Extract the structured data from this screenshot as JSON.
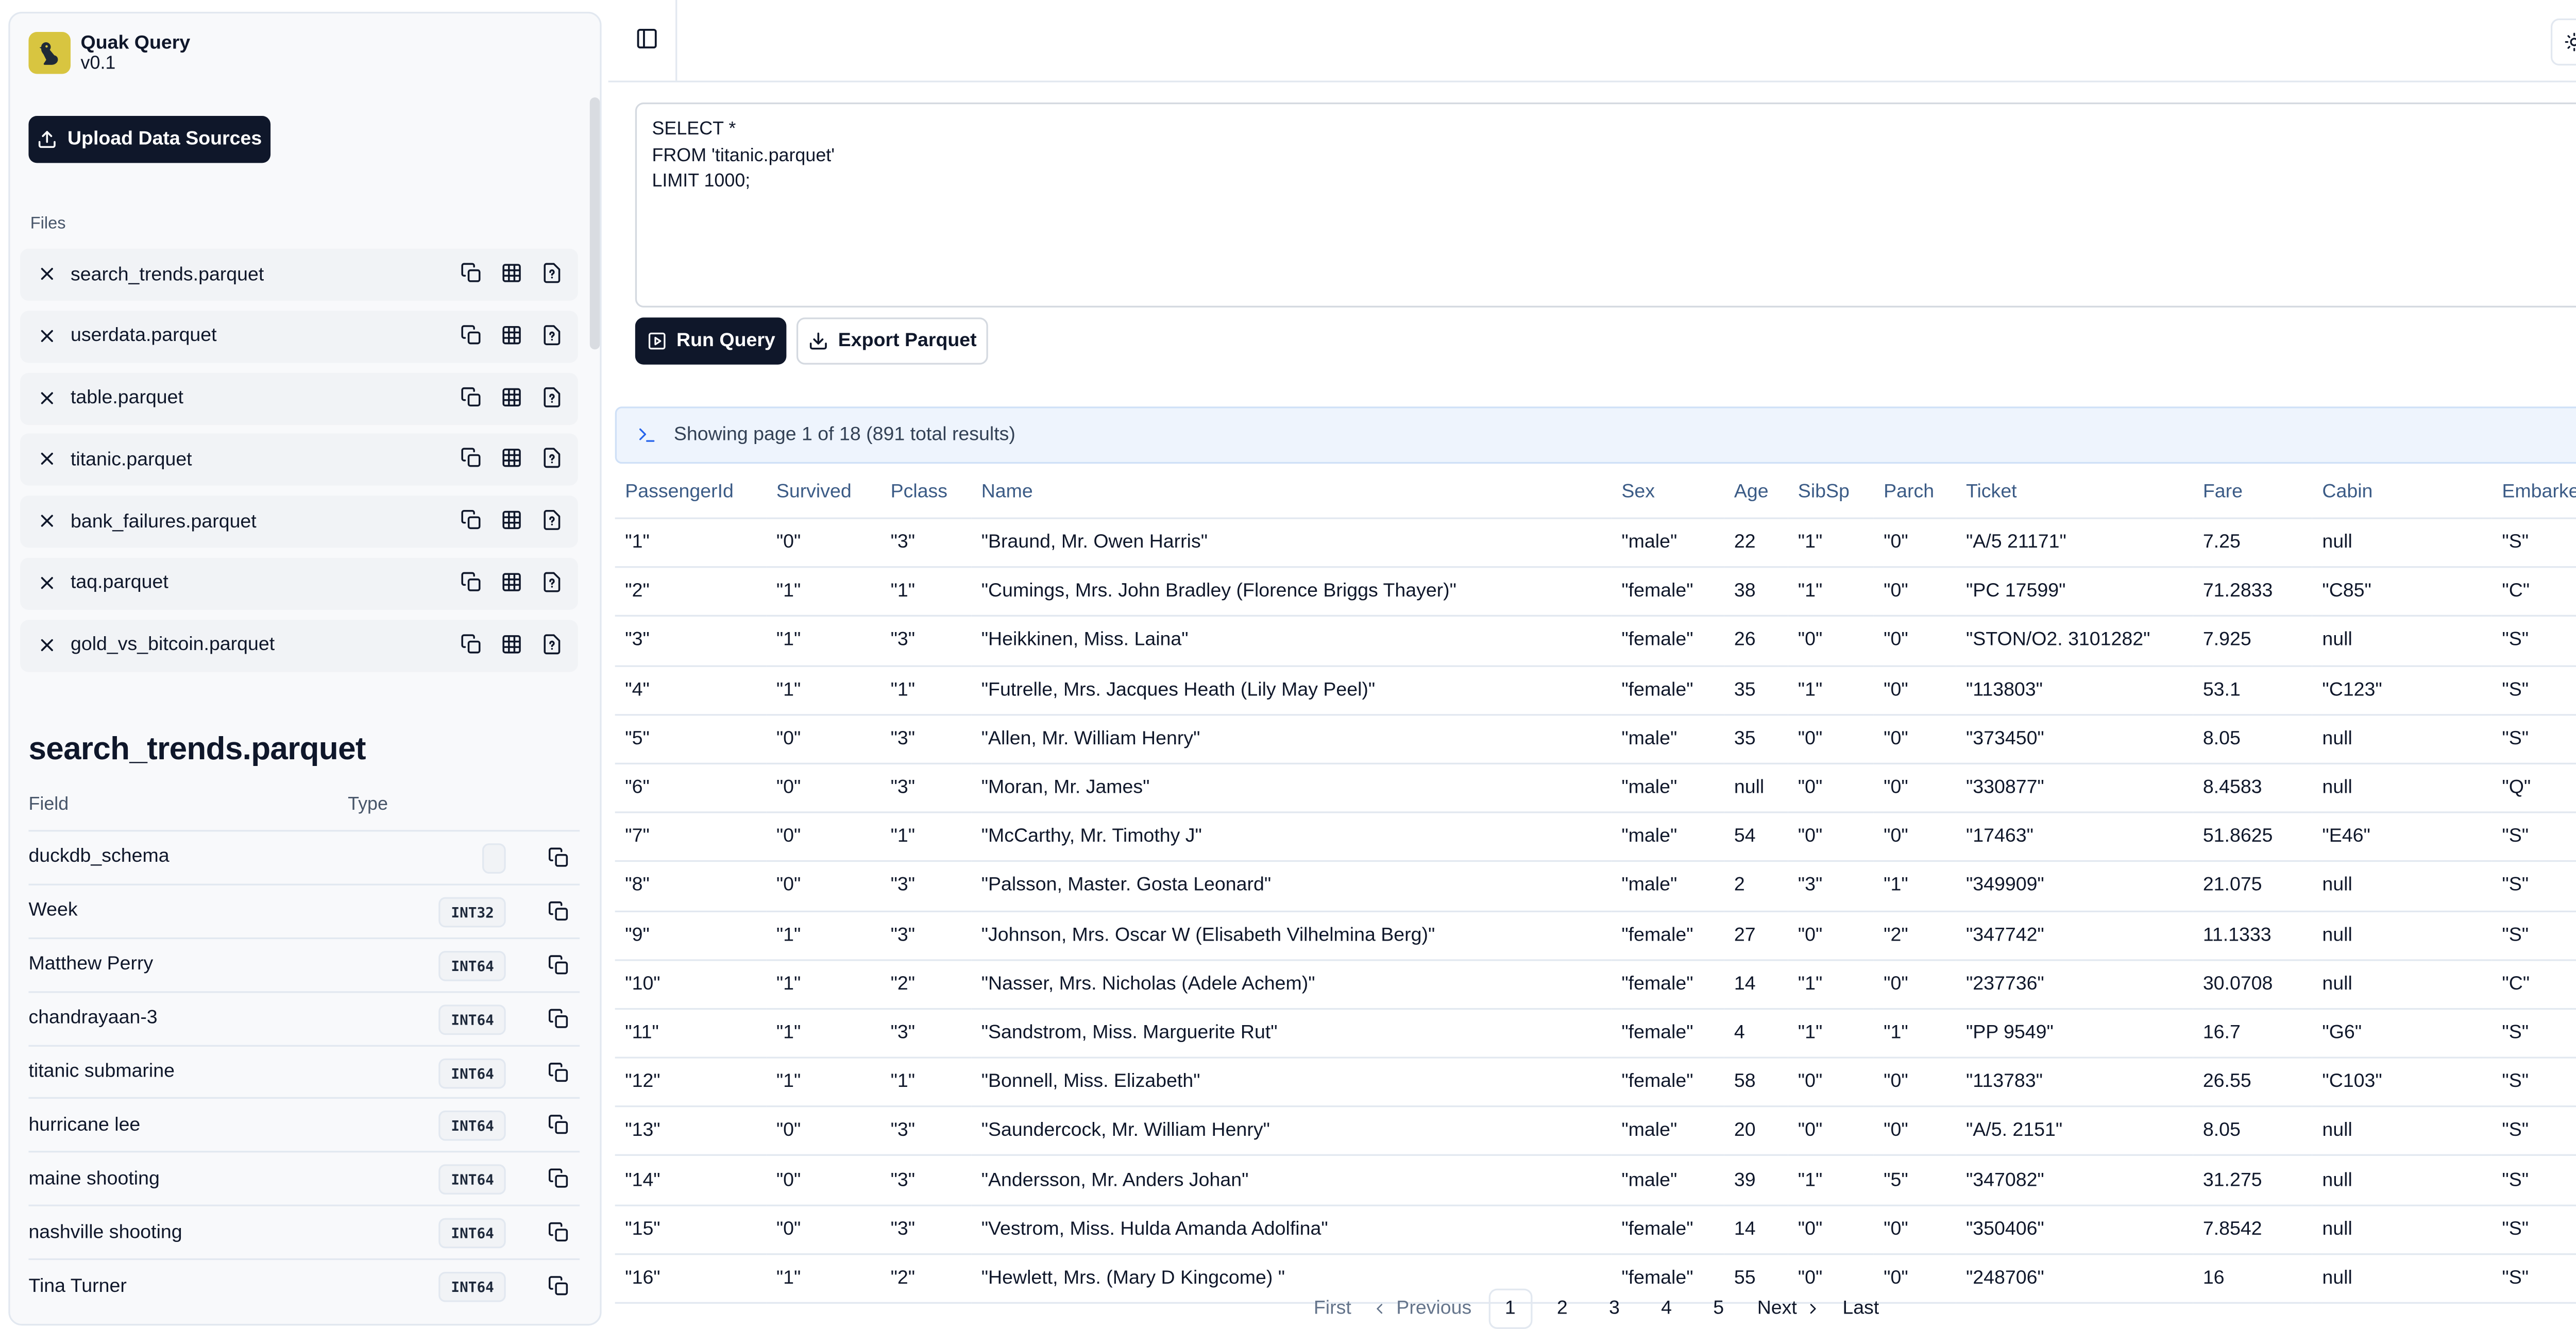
{
  "app": {
    "title": "Quak Query",
    "version": "v0.1",
    "upload_label": "Upload Data Sources",
    "files_heading": "Files"
  },
  "files": [
    {
      "name": "search_trends.parquet"
    },
    {
      "name": "userdata.parquet"
    },
    {
      "name": "table.parquet"
    },
    {
      "name": "titanic.parquet"
    },
    {
      "name": "bank_failures.parquet"
    },
    {
      "name": "taq.parquet"
    },
    {
      "name": "gold_vs_bitcoin.parquet"
    }
  ],
  "schema": {
    "title": "search_trends.parquet",
    "field_header": "Field",
    "type_header": "Type",
    "rows": [
      {
        "field": "duckdb_schema",
        "type": ""
      },
      {
        "field": "Week",
        "type": "INT32"
      },
      {
        "field": "Matthew Perry",
        "type": "INT64"
      },
      {
        "field": "chandrayaan-3",
        "type": "INT64"
      },
      {
        "field": "titanic submarine",
        "type": "INT64"
      },
      {
        "field": "hurricane lee",
        "type": "INT64"
      },
      {
        "field": "maine shooting",
        "type": "INT64"
      },
      {
        "field": "nashville shooting",
        "type": "INT64"
      },
      {
        "field": "Tina Turner",
        "type": "INT64"
      }
    ]
  },
  "editor": {
    "query": "SELECT *\nFROM 'titanic.parquet'\nLIMIT 1000;"
  },
  "actions": {
    "run_label": "Run Query",
    "export_label": "Export Parquet"
  },
  "status": {
    "text": "Showing page 1 of 18 (891 total results)"
  },
  "results": {
    "columns": [
      "PassengerId",
      "Survived",
      "Pclass",
      "Name",
      "Sex",
      "Age",
      "SibSp",
      "Parch",
      "Ticket",
      "Fare",
      "Cabin",
      "Embarked"
    ],
    "rows": [
      [
        "\"1\"",
        "\"0\"",
        "\"3\"",
        "\"Braund, Mr. Owen Harris\"",
        "\"male\"",
        "22",
        "\"1\"",
        "\"0\"",
        "\"A/5 21171\"",
        "7.25",
        "null",
        "\"S\""
      ],
      [
        "\"2\"",
        "\"1\"",
        "\"1\"",
        "\"Cumings, Mrs. John Bradley (Florence Briggs Thayer)\"",
        "\"female\"",
        "38",
        "\"1\"",
        "\"0\"",
        "\"PC 17599\"",
        "71.2833",
        "\"C85\"",
        "\"C\""
      ],
      [
        "\"3\"",
        "\"1\"",
        "\"3\"",
        "\"Heikkinen, Miss. Laina\"",
        "\"female\"",
        "26",
        "\"0\"",
        "\"0\"",
        "\"STON/O2. 3101282\"",
        "7.925",
        "null",
        "\"S\""
      ],
      [
        "\"4\"",
        "\"1\"",
        "\"1\"",
        "\"Futrelle, Mrs. Jacques Heath (Lily May Peel)\"",
        "\"female\"",
        "35",
        "\"1\"",
        "\"0\"",
        "\"113803\"",
        "53.1",
        "\"C123\"",
        "\"S\""
      ],
      [
        "\"5\"",
        "\"0\"",
        "\"3\"",
        "\"Allen, Mr. William Henry\"",
        "\"male\"",
        "35",
        "\"0\"",
        "\"0\"",
        "\"373450\"",
        "8.05",
        "null",
        "\"S\""
      ],
      [
        "\"6\"",
        "\"0\"",
        "\"3\"",
        "\"Moran, Mr. James\"",
        "\"male\"",
        "null",
        "\"0\"",
        "\"0\"",
        "\"330877\"",
        "8.4583",
        "null",
        "\"Q\""
      ],
      [
        "\"7\"",
        "\"0\"",
        "\"1\"",
        "\"McCarthy, Mr. Timothy J\"",
        "\"male\"",
        "54",
        "\"0\"",
        "\"0\"",
        "\"17463\"",
        "51.8625",
        "\"E46\"",
        "\"S\""
      ],
      [
        "\"8\"",
        "\"0\"",
        "\"3\"",
        "\"Palsson, Master. Gosta Leonard\"",
        "\"male\"",
        "2",
        "\"3\"",
        "\"1\"",
        "\"349909\"",
        "21.075",
        "null",
        "\"S\""
      ],
      [
        "\"9\"",
        "\"1\"",
        "\"3\"",
        "\"Johnson, Mrs. Oscar W (Elisabeth Vilhelmina Berg)\"",
        "\"female\"",
        "27",
        "\"0\"",
        "\"2\"",
        "\"347742\"",
        "11.1333",
        "null",
        "\"S\""
      ],
      [
        "\"10\"",
        "\"1\"",
        "\"2\"",
        "\"Nasser, Mrs. Nicholas (Adele Achem)\"",
        "\"female\"",
        "14",
        "\"1\"",
        "\"0\"",
        "\"237736\"",
        "30.0708",
        "null",
        "\"C\""
      ],
      [
        "\"11\"",
        "\"1\"",
        "\"3\"",
        "\"Sandstrom, Miss. Marguerite Rut\"",
        "\"female\"",
        "4",
        "\"1\"",
        "\"1\"",
        "\"PP 9549\"",
        "16.7",
        "\"G6\"",
        "\"S\""
      ],
      [
        "\"12\"",
        "\"1\"",
        "\"1\"",
        "\"Bonnell, Miss. Elizabeth\"",
        "\"female\"",
        "58",
        "\"0\"",
        "\"0\"",
        "\"113783\"",
        "26.55",
        "\"C103\"",
        "\"S\""
      ],
      [
        "\"13\"",
        "\"0\"",
        "\"3\"",
        "\"Saundercock, Mr. William Henry\"",
        "\"male\"",
        "20",
        "\"0\"",
        "\"0\"",
        "\"A/5. 2151\"",
        "8.05",
        "null",
        "\"S\""
      ],
      [
        "\"14\"",
        "\"0\"",
        "\"3\"",
        "\"Andersson, Mr. Anders Johan\"",
        "\"male\"",
        "39",
        "\"1\"",
        "\"5\"",
        "\"347082\"",
        "31.275",
        "null",
        "\"S\""
      ],
      [
        "\"15\"",
        "\"0\"",
        "\"3\"",
        "\"Vestrom, Miss. Hulda Amanda Adolfina\"",
        "\"female\"",
        "14",
        "\"0\"",
        "\"0\"",
        "\"350406\"",
        "7.8542",
        "null",
        "\"S\""
      ],
      [
        "\"16\"",
        "\"1\"",
        "\"2\"",
        "\"Hewlett, Mrs. (Mary D Kingcome) \"",
        "\"female\"",
        "55",
        "\"0\"",
        "\"0\"",
        "\"248706\"",
        "16",
        "null",
        "\"S\""
      ]
    ]
  },
  "pagination": {
    "first": "First",
    "previous": "Previous",
    "pages": [
      "1",
      "2",
      "3",
      "4",
      "5"
    ],
    "current": "1",
    "next": "Next",
    "last": "Last"
  },
  "icons": {
    "brand": "duck-logo-icon",
    "upload": "upload-icon",
    "remove": "close-icon",
    "copy": "copy-icon",
    "table": "table-icon",
    "info": "file-question-icon",
    "sidebar_toggle": "panel-left-icon",
    "theme": "sun-icon",
    "run": "play-square-icon",
    "export": "download-icon",
    "terminal": "terminal-icon"
  },
  "colors": {
    "primary": "#0f172a",
    "brand_logo": "#d8c540",
    "status_bg": "#eef4fd",
    "header_text": "#3b5b86"
  }
}
